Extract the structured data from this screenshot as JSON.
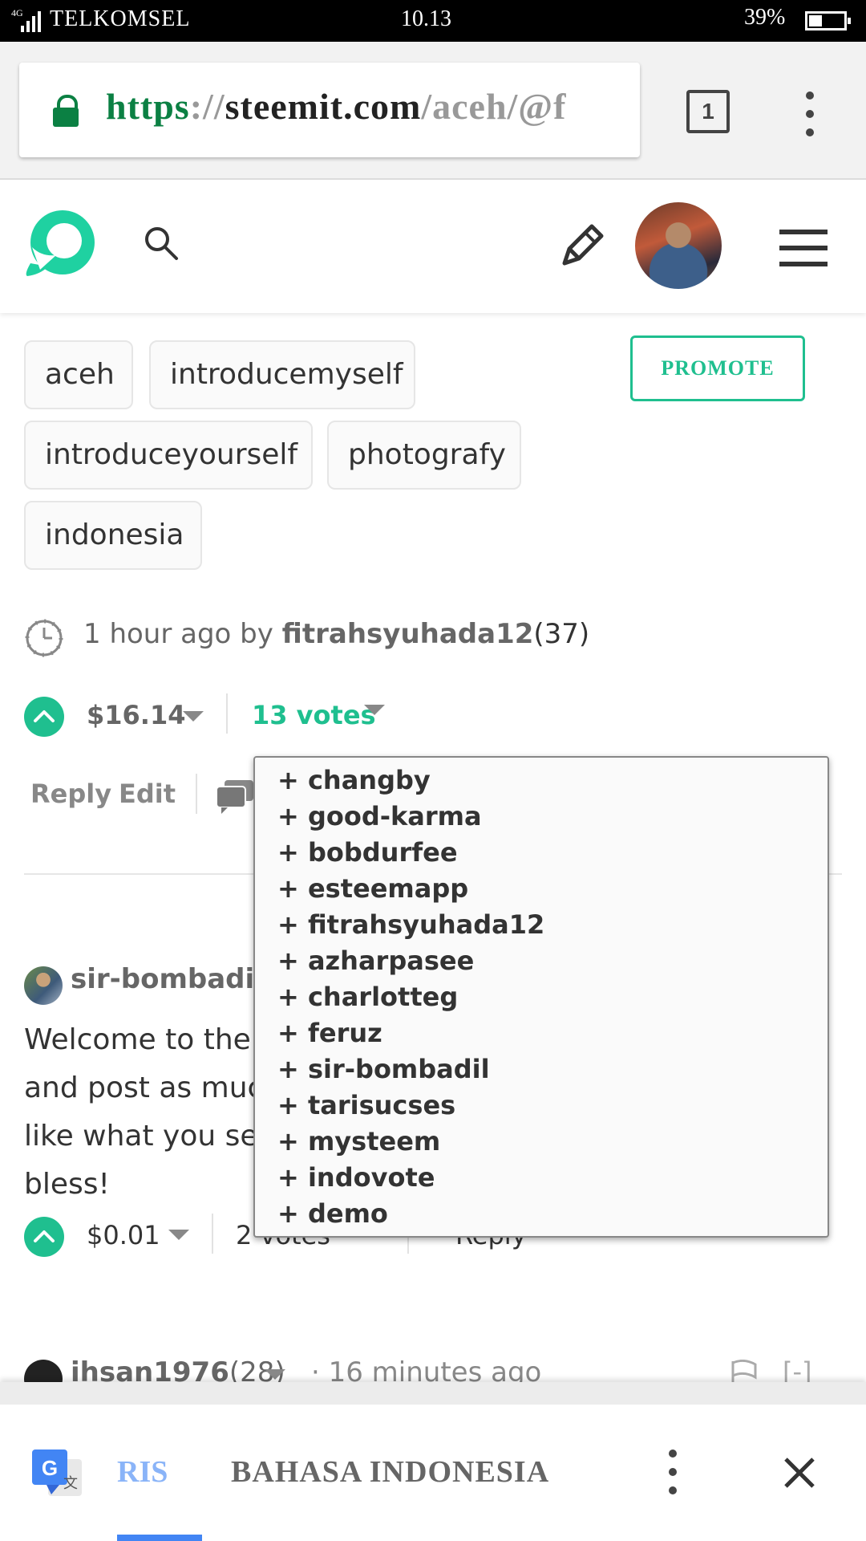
{
  "status_bar": {
    "network": "4G",
    "carrier": "TELKOMSEL",
    "time": "10.13",
    "battery": "39%"
  },
  "browser": {
    "url_scheme": "https",
    "url_sep": "://",
    "url_host": "steemit.com",
    "url_path": "/aceh/@f",
    "tab_count": "1",
    "secure_color": "#0b8043"
  },
  "header": {
    "brand_color": "#1fbf8f",
    "icons": [
      "steemit-logo-icon",
      "search-icon",
      "pen-icon",
      "avatar",
      "hamburger-icon"
    ]
  },
  "tags": [
    "aceh",
    "introducemyself",
    "introduceyourself",
    "photografy",
    "indonesia"
  ],
  "promote_label": "PROMOTE",
  "post": {
    "time_prefix": "1 hour ago by",
    "author": "fitrahsyuhada12",
    "reputation": "(37)",
    "payout": "$16.14",
    "votes_label": "13 votes",
    "reply_label": "Reply",
    "edit_label": "Edit"
  },
  "voters": [
    "+ changby",
    "+ good-karma",
    "+ bobdurfee",
    "+ esteemapp",
    "+ fitrahsyuhada12",
    "+ azharpasee",
    "+ charlotteg",
    "+ feruz",
    "+ sir-bombadil",
    "+ tarisucses",
    "+ mysteem",
    "+ indovote",
    "+ demo"
  ],
  "comment": {
    "author": "sir-bombadil",
    "author_suffix": " (",
    "body_lines": [
      "Welcome to the p",
      "and post as muc",
      "like what you see",
      "bless!"
    ],
    "payout": "$0.01",
    "votes_label": "2 votes",
    "reply_label": "Reply"
  },
  "next_comment": {
    "author": "ihsan1976",
    "reputation": "(28)",
    "time": "· 16 minutes ago",
    "collapse": "[-]"
  },
  "translate_bar": {
    "lang_from": "RIS",
    "lang_to": "BAHASA INDONESIA"
  }
}
